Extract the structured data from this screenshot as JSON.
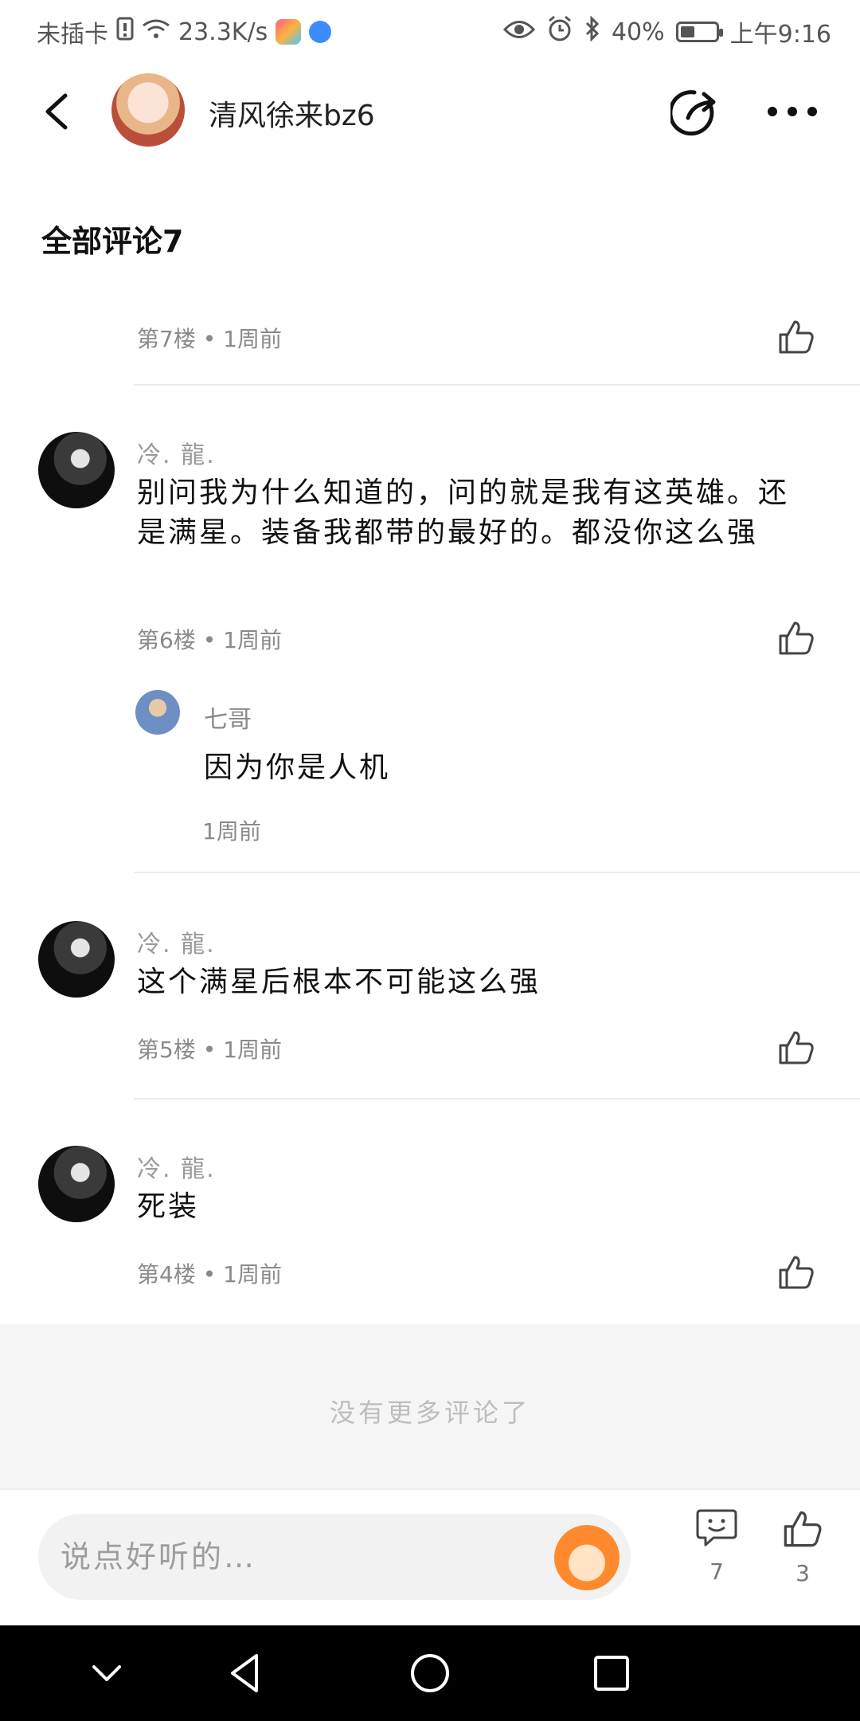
{
  "status_bar": {
    "carrier": "未插卡",
    "speed": "23.3K/s",
    "battery": "40%",
    "battery_level": 0.4,
    "time": "上午9:16"
  },
  "header": {
    "username": "清风徐来bz6"
  },
  "section": {
    "title": "全部评论7"
  },
  "comments": [
    {
      "meta": "第7楼 • 1周前"
    },
    {
      "author": "冷.    龍.",
      "text": "别问我为什么知道的，问的就是我有这英雄。还是满星。装备我都带的最好的。都没你这么强",
      "meta": "第6楼 • 1周前",
      "reply": {
        "author": "七哥",
        "text": "因为你是人机",
        "time": "1周前"
      }
    },
    {
      "author": "冷.    龍.",
      "text": "这个满星后根本不可能这么强",
      "meta": "第5楼 • 1周前"
    },
    {
      "author": "冷.    龍.",
      "text": "死装",
      "meta": "第4楼 • 1周前"
    }
  ],
  "footer": {
    "no_more": "没有更多评论了"
  },
  "bottom_bar": {
    "placeholder": "说点好听的…",
    "comment_count": "7",
    "like_count": "3"
  },
  "icons": {
    "back": "back-arrow-icon",
    "share": "share-icon",
    "more": "more-dots-icon",
    "like": "thumbs-up-icon",
    "comment": "comment-bubble-icon",
    "emoji": "emoji-icon"
  }
}
